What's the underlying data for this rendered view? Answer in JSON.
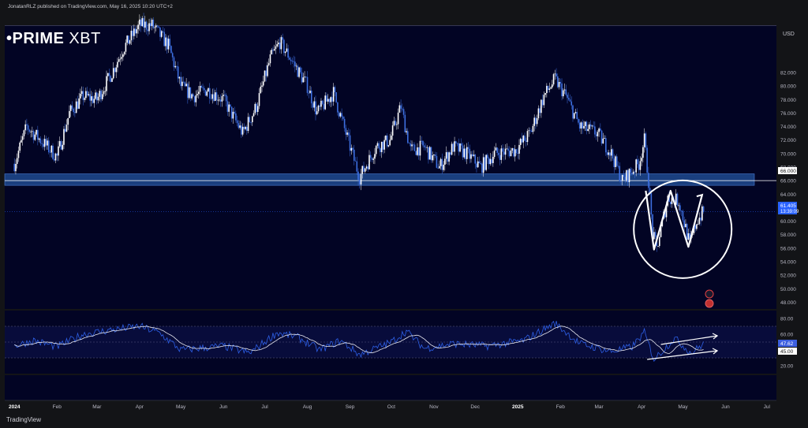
{
  "header": {
    "attribution": "JonatanRLZ published on TradingView.com, May 16, 2025 10:20 UTC+2",
    "brand": {
      "bold": "•PRIME",
      "thin": " XBT"
    }
  },
  "footer": {
    "logo_text": "TradingView"
  },
  "colors": {
    "background": "#020424",
    "up_candle": "#ffffff",
    "down_candle": "#3d6fe0",
    "support_zone": "#1f4a8f",
    "rsi_line": "#2d5fe6",
    "rsi_ma": "#e8e8f0",
    "price_label": "#2962ff"
  },
  "chart_data": {
    "type": "candlestick",
    "currency_label": "USD",
    "price_axis": {
      "range": [
        47,
        89
      ],
      "ticks": [
        82000,
        80000,
        78000,
        76000,
        74000,
        72000,
        70000,
        68000,
        66000,
        64000,
        62000,
        60000,
        58000,
        56000,
        54000,
        52000,
        50000,
        48000
      ],
      "tick_labels": [
        "82.000",
        "80.000",
        "78.000",
        "76.000",
        "74.000",
        "72.000",
        "70.000",
        "68.000",
        "66.000",
        "64.000",
        "62.000",
        "60.000",
        "58.000",
        "56.000",
        "54.000",
        "52.000",
        "50.000",
        "48.000"
      ]
    },
    "price_labels": {
      "level": "66.000",
      "last": "61.405",
      "countdown": "13:39:09"
    },
    "support_zone": [
      65.3,
      67.0
    ],
    "horizontal_level": 66.0,
    "time_axis": {
      "labels": [
        "2024",
        "Feb",
        "Mar",
        "Apr",
        "May",
        "Jun",
        "Jul",
        "Aug",
        "Sep",
        "Oct",
        "Nov",
        "Dec",
        "2025",
        "Feb",
        "Mar",
        "Apr",
        "May",
        "Jun",
        "Jul"
      ],
      "bold": [
        "2024",
        "2025"
      ]
    },
    "price_path": [
      [
        "2024-01-01",
        68.5
      ],
      [
        "2024-01-10",
        74.0
      ],
      [
        "2024-01-20",
        72.0
      ],
      [
        "2024-02-01",
        69.5
      ],
      [
        "2024-02-10",
        76.0
      ],
      [
        "2024-02-20",
        78.5
      ],
      [
        "2024-03-01",
        78.0
      ],
      [
        "2024-03-12",
        82.0
      ],
      [
        "2024-03-20",
        85.5
      ],
      [
        "2024-04-01",
        89.0
      ],
      [
        "2024-04-10",
        89.0
      ],
      [
        "2024-04-22",
        86.0
      ],
      [
        "2024-05-01",
        80.0
      ],
      [
        "2024-05-10",
        78.5
      ],
      [
        "2024-05-20",
        79.5
      ],
      [
        "2024-06-01",
        78.0
      ],
      [
        "2024-06-15",
        73.0
      ],
      [
        "2024-06-25",
        77.0
      ],
      [
        "2024-07-05",
        84.0
      ],
      [
        "2024-07-12",
        86.5
      ],
      [
        "2024-07-20",
        84.0
      ],
      [
        "2024-08-01",
        80.0
      ],
      [
        "2024-08-08",
        76.0
      ],
      [
        "2024-08-20",
        79.0
      ],
      [
        "2024-09-01",
        71.0
      ],
      [
        "2024-09-08",
        66.5
      ],
      [
        "2024-09-20",
        71.0
      ],
      [
        "2024-09-30",
        72.0
      ],
      [
        "2024-10-08",
        77.0
      ],
      [
        "2024-10-15",
        70.5
      ],
      [
        "2024-10-25",
        71.0
      ],
      [
        "2024-11-05",
        68.0
      ],
      [
        "2024-11-15",
        71.0
      ],
      [
        "2024-11-25",
        70.0
      ],
      [
        "2024-12-05",
        68.0
      ],
      [
        "2024-12-15",
        70.0
      ],
      [
        "2024-12-30",
        70.5
      ],
      [
        "2025-01-10",
        73.0
      ],
      [
        "2025-01-20",
        78.5
      ],
      [
        "2025-01-28",
        81.0
      ],
      [
        "2025-02-05",
        78.5
      ],
      [
        "2025-02-15",
        74.0
      ],
      [
        "2025-02-28",
        73.0
      ],
      [
        "2025-03-10",
        70.0
      ],
      [
        "2025-03-18",
        66.0
      ],
      [
        "2025-03-30",
        68.5
      ],
      [
        "2025-04-03",
        72.0
      ],
      [
        "2025-04-06",
        66.0
      ],
      [
        "2025-04-09",
        58.0
      ],
      [
        "2025-04-12",
        56.0
      ],
      [
        "2025-04-20",
        63.5
      ],
      [
        "2025-04-28",
        63.0
      ],
      [
        "2025-05-06",
        56.5
      ],
      [
        "2025-05-11",
        60.0
      ],
      [
        "2025-05-16",
        61.4
      ]
    ],
    "rsi": {
      "range": [
        10,
        90
      ],
      "ticks": [
        80,
        60,
        40,
        20
      ],
      "tick_labels": [
        "80.00",
        "60.00",
        "40.00",
        "20.00"
      ],
      "badges": [
        "47.62",
        "45.00"
      ],
      "bands": [
        70,
        50,
        30
      ],
      "path": [
        [
          "2024-01-01",
          45
        ],
        [
          "2024-01-15",
          52
        ],
        [
          "2024-02-01",
          44
        ],
        [
          "2024-02-20",
          60
        ],
        [
          "2024-03-10",
          65
        ],
        [
          "2024-04-01",
          70
        ],
        [
          "2024-04-15",
          62
        ],
        [
          "2024-05-01",
          40
        ],
        [
          "2024-06-01",
          45
        ],
        [
          "2024-06-20",
          36
        ],
        [
          "2024-07-10",
          62
        ],
        [
          "2024-07-25",
          56
        ],
        [
          "2024-08-10",
          40
        ],
        [
          "2024-08-25",
          52
        ],
        [
          "2024-09-08",
          34
        ],
        [
          "2024-10-01",
          50
        ],
        [
          "2024-10-12",
          64
        ],
        [
          "2024-10-25",
          42
        ],
        [
          "2024-11-15",
          48
        ],
        [
          "2024-12-10",
          45
        ],
        [
          "2025-01-05",
          52
        ],
        [
          "2025-01-28",
          74
        ],
        [
          "2025-02-15",
          48
        ],
        [
          "2025-03-10",
          38
        ],
        [
          "2025-03-25",
          44
        ],
        [
          "2025-04-03",
          62
        ],
        [
          "2025-04-10",
          28
        ],
        [
          "2025-04-25",
          55
        ],
        [
          "2025-05-07",
          36
        ],
        [
          "2025-05-16",
          48
        ]
      ]
    },
    "annotations": {
      "circle_center": [
        "2025-05-02",
        58.8
      ],
      "w_pattern": [
        [
          "2025-04-04",
          64.5
        ],
        [
          "2025-04-10",
          55.8
        ],
        [
          "2025-04-22",
          64.5
        ],
        [
          "2025-05-05",
          56.2
        ],
        [
          "2025-05-15",
          63.9
        ]
      ],
      "rsi_trend_arrows": [
        [
          [
            "2025-04-15",
            47
          ],
          [
            "2025-05-26",
            58
          ]
        ],
        [
          [
            "2025-04-05",
            28
          ],
          [
            "2025-05-26",
            39
          ]
        ]
      ]
    }
  }
}
